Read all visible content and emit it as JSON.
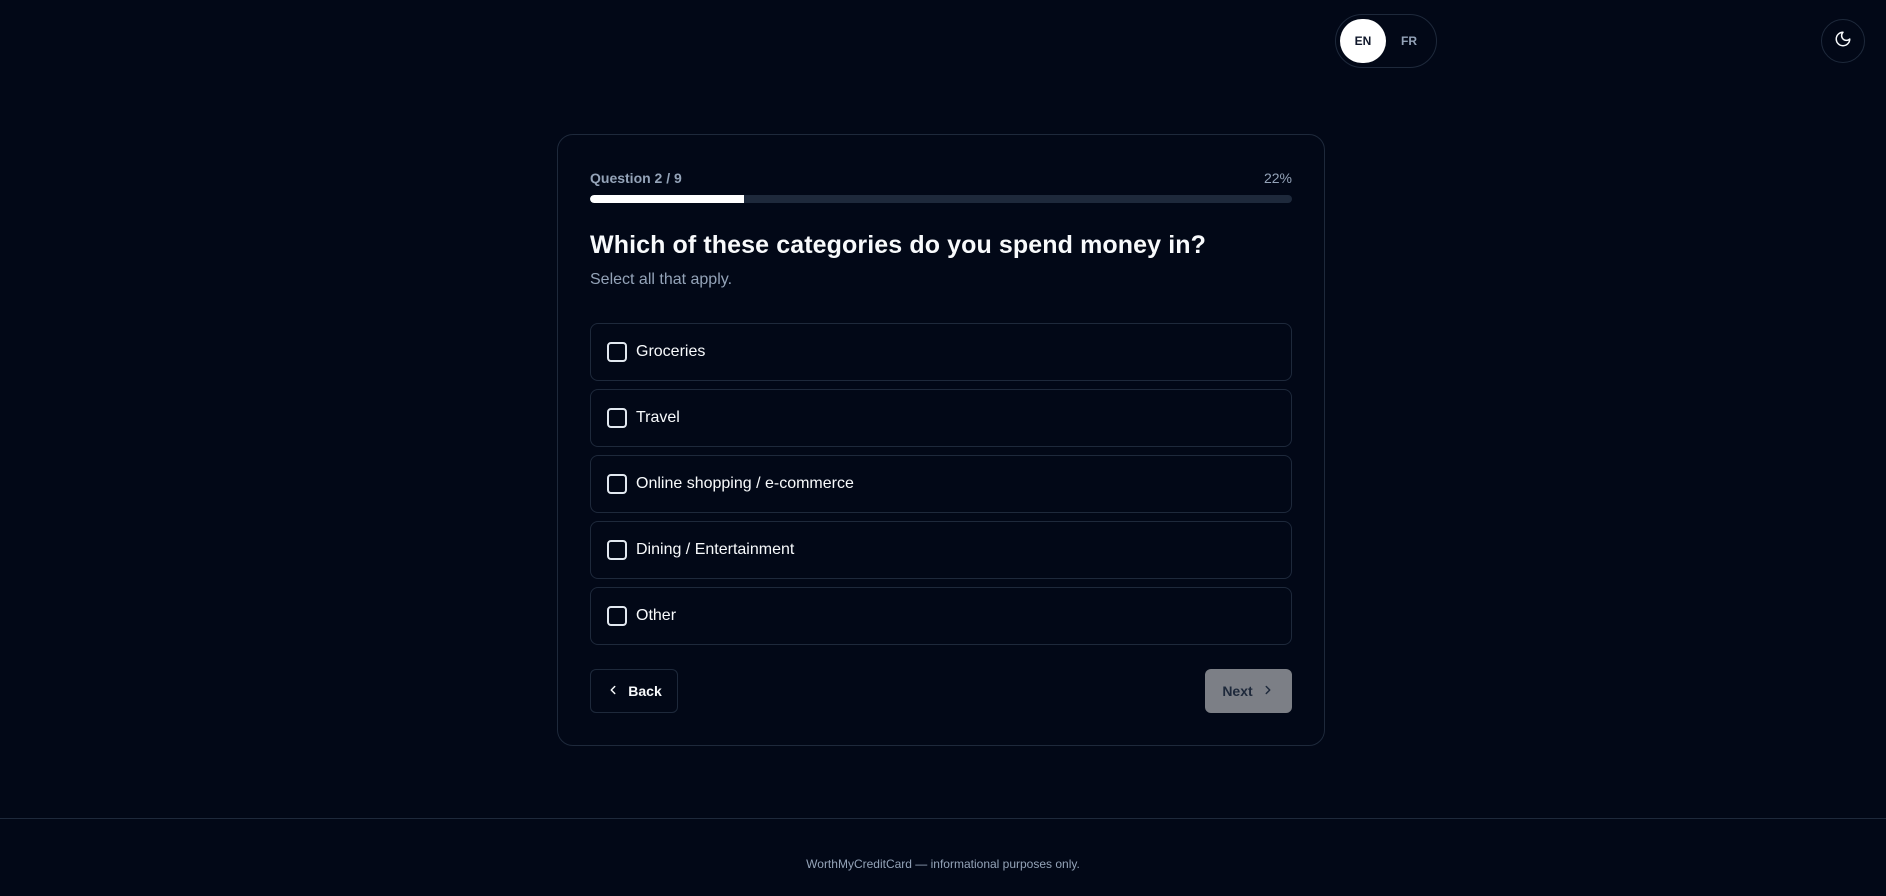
{
  "language_toggle": {
    "options": [
      {
        "label": "EN",
        "active": true
      },
      {
        "label": "FR",
        "active": false
      }
    ]
  },
  "theme_toggle": {
    "icon": "moon-icon"
  },
  "quiz": {
    "progress_label": "Question 2 / 9",
    "progress_percent_label": "22%",
    "progress_fraction": 0.22,
    "question": "Which of these categories do you spend money in?",
    "hint": "Select all that apply.",
    "options": [
      {
        "label": "Groceries",
        "checked": false
      },
      {
        "label": "Travel",
        "checked": false
      },
      {
        "label": "Online shopping / e-commerce",
        "checked": false
      },
      {
        "label": "Dining / Entertainment",
        "checked": false
      },
      {
        "label": "Other",
        "checked": false
      }
    ],
    "back_label": "Back",
    "next_label": "Next"
  },
  "footer": {
    "text": "WorthMyCreditCard — informational purposes only."
  },
  "colors": {
    "background": "#020817",
    "border": "#1e293b",
    "muted_text": "#94a3b8",
    "progress_fill": "#ffffff",
    "next_disabled": "#7c7f86"
  }
}
